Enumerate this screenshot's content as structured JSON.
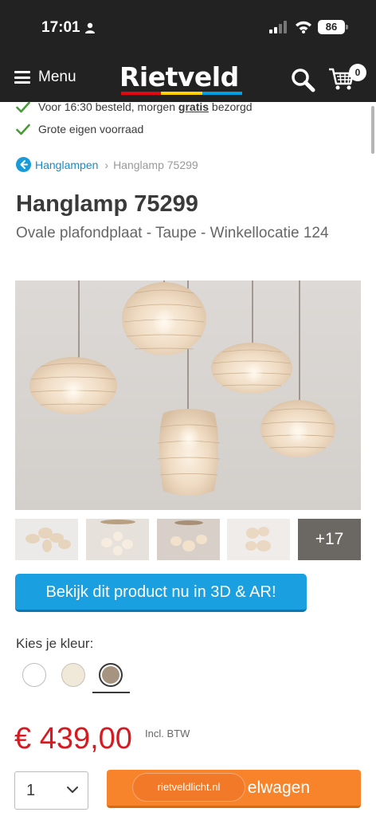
{
  "status_bar": {
    "time": "17:01",
    "battery": "86"
  },
  "header": {
    "menu_label": "Menu",
    "logo": "Rietveld",
    "cart_count": "0",
    "brand_colors": [
      "#e30613",
      "#ffd200",
      "#009fe3"
    ]
  },
  "usps": [
    {
      "text_before": "Voor 16:30 besteld, morgen ",
      "bold": "gratis",
      "text_after": " bezorgd"
    },
    {
      "text": "Grote eigen voorraad"
    }
  ],
  "breadcrumb": {
    "parent": "Hanglampen",
    "current": "Hanglamp 75299"
  },
  "product": {
    "title": "Hanglamp 75299",
    "subtitle": "Ovale plafondplaat - Taupe - Winkellocatie 124",
    "more_images": "+17",
    "ar_button": "Bekijk dit product nu in 3D & AR!",
    "color_label": "Kies je kleur:",
    "colors": [
      {
        "name": "white",
        "hex": "#ffffff"
      },
      {
        "name": "cream",
        "hex": "#f0e8d8"
      },
      {
        "name": "taupe",
        "hex": "#a69480",
        "selected": true
      }
    ],
    "price": "€ 439,00",
    "vat_note": "Incl. BTW",
    "quantity": "1",
    "add_to_cart_tail": "elwagen",
    "url_overlay": "rietveldlicht.nl"
  },
  "accent_colors": {
    "link": "#1a8ac7",
    "price": "#d71920",
    "cta": "#f7842a",
    "ar": "#1aa0e0"
  }
}
